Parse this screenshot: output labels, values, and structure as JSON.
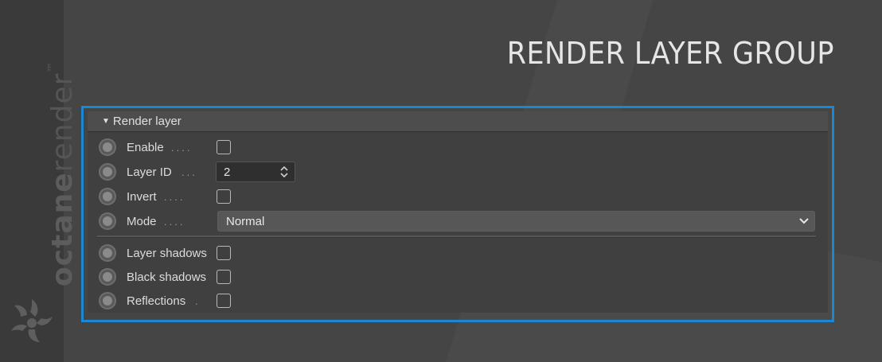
{
  "brand": {
    "name_light": "octane",
    "name_bold": "render",
    "trademark": "™"
  },
  "page_title": "RENDER LAYER GROUP",
  "section": {
    "title": "Render layer",
    "expanded": true
  },
  "rows": {
    "enable": {
      "label": "Enable",
      "checked": false
    },
    "layer_id": {
      "label": "Layer ID",
      "value": "2"
    },
    "invert": {
      "label": "Invert",
      "checked": false
    },
    "mode": {
      "label": "Mode",
      "value": "Normal"
    },
    "layer_shadows": {
      "label": "Layer shadows",
      "checked": false
    },
    "black_shadows": {
      "label": "Black shadows",
      "checked": false
    },
    "reflections": {
      "label": "Reflections",
      "checked": false
    }
  },
  "colors": {
    "background": "#454545",
    "highlight_border": "#1b86d1",
    "panel": "#404040"
  },
  "icons": {
    "pin": "circle-pin-icon",
    "spinner": "up-down-arrows-icon",
    "dropdown": "chevron-down-icon",
    "collapse": "triangle-down-icon",
    "logo": "octane-logo-icon"
  }
}
